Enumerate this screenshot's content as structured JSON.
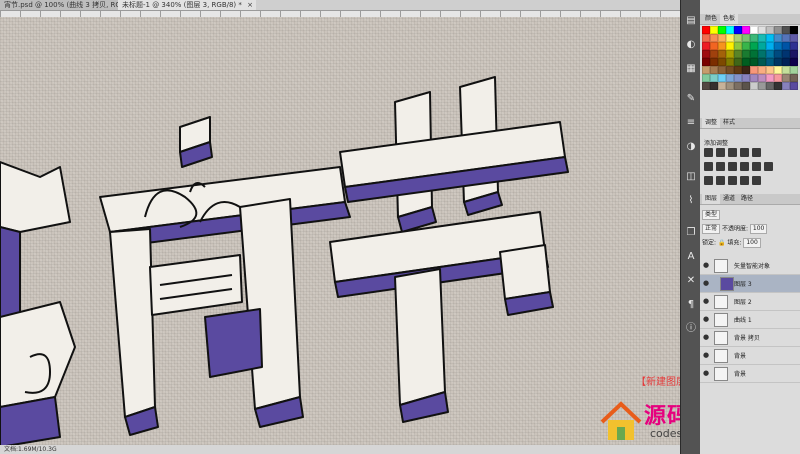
{
  "tabs": [
    {
      "label": "宵节.psd @ 100% (曲线 3 拷贝, RGB/8)",
      "close": "×"
    },
    {
      "label": "未标题-1 @ 340% (图层 3, RGB/8) *",
      "close": "×"
    }
  ],
  "status": {
    "text": "文档:1.69M/10.3G"
  },
  "annotation": {
    "text": "【新建图层】并【创建剪切蒙版"
  },
  "watermark": {
    "title": "源码搜藏网",
    "url": "codesocang.com"
  },
  "panels": {
    "color_tabs": [
      "颜色",
      "色板"
    ],
    "adjust_tabs": [
      "调整",
      "样式"
    ],
    "adjust_add": "添加调整",
    "layer_tabs": [
      "图层",
      "通道",
      "路径"
    ],
    "filter_kind": "类型",
    "blend_mode": "正常",
    "opacity_label": "不透明度:",
    "opacity_value": "100",
    "lock_label": "锁定:",
    "fill_label": "填充:",
    "fill_value": "100"
  },
  "layers": [
    {
      "name": "矢量智能对象",
      "selected": false
    },
    {
      "name": "图层 3",
      "selected": true
    },
    {
      "name": "图层 2",
      "selected": false
    },
    {
      "name": "曲线 1",
      "selected": false
    },
    {
      "name": "背景 拷贝",
      "selected": false
    },
    {
      "name": "背景",
      "selected": false
    },
    {
      "name": "背景",
      "selected": false
    }
  ],
  "colors": {
    "accent_purple": "#5a4aa0",
    "annotation_red": "#e53a3a",
    "watermark_pink": "#e6007e"
  }
}
